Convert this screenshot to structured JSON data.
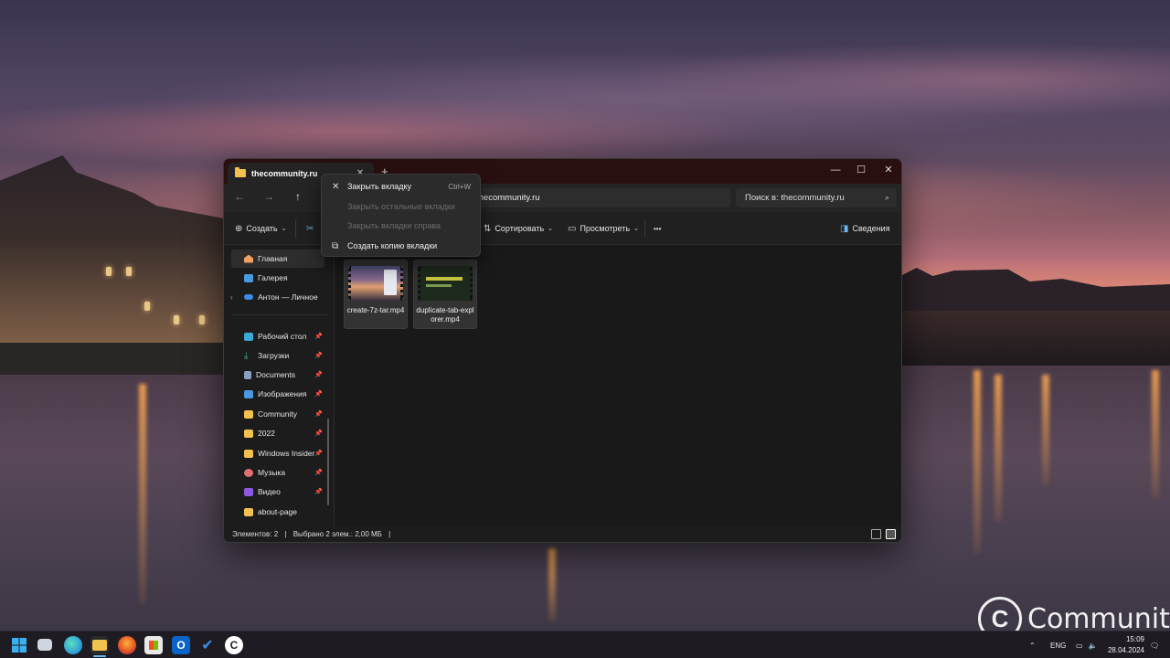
{
  "window": {
    "tab_title": "thecommunity.ru",
    "tab_close": "✕",
    "new_tab": "+",
    "minimize": "—",
    "maximize": "☐",
    "close": "✕"
  },
  "nav": {
    "back": "←",
    "forward": "→",
    "up": "↑",
    "address": "thecommunity.ru",
    "search_placeholder": "Поиск в: thecommunity.ru"
  },
  "toolbar": {
    "create_label": "Создать",
    "sort_label": "Сортировать",
    "view_label": "Просмотреть",
    "more_label": "•••",
    "details_label": "Сведения"
  },
  "context_menu": {
    "items": [
      {
        "label": "Закрыть вкладку",
        "shortcut": "Ctrl+W",
        "icon": "close-icon",
        "enabled": true
      },
      {
        "label": "Закрыть остальные вкладки",
        "shortcut": "",
        "icon": "",
        "enabled": false
      },
      {
        "label": "Закрыть вкладки справа",
        "shortcut": "",
        "icon": "",
        "enabled": false
      },
      {
        "label": "Создать копию вкладки",
        "shortcut": "",
        "icon": "duplicate-icon",
        "enabled": true
      }
    ]
  },
  "sidebar": {
    "items": [
      {
        "label": "Главная",
        "icon": "home-icon",
        "pinned": false
      },
      {
        "label": "Галерея",
        "icon": "gallery-icon",
        "pinned": false
      },
      {
        "label": "Антон — Личное",
        "icon": "onedrive-icon",
        "pinned": false
      },
      {
        "label": "Рабочий стол",
        "icon": "desktop-icon",
        "pinned": true
      },
      {
        "label": "Загрузки",
        "icon": "download-icon",
        "pinned": true
      },
      {
        "label": "Documents",
        "icon": "documents-icon",
        "pinned": true
      },
      {
        "label": "Изображения",
        "icon": "pictures-icon",
        "pinned": true
      },
      {
        "label": "Community",
        "icon": "folder-icon",
        "pinned": true
      },
      {
        "label": "2022",
        "icon": "folder-icon",
        "pinned": true
      },
      {
        "label": "Windows Insider",
        "icon": "folder-icon",
        "pinned": true
      },
      {
        "label": "Музыка",
        "icon": "music-icon",
        "pinned": true
      },
      {
        "label": "Видео",
        "icon": "video-icon",
        "pinned": true
      },
      {
        "label": "about-page",
        "icon": "folder-icon",
        "pinned": false
      }
    ]
  },
  "files": [
    {
      "name": "create-7z-tar.mp4"
    },
    {
      "name": "duplicate-tab-explorer.mp4"
    }
  ],
  "status": {
    "count": "Элементов: 2",
    "selected": "Выбрано 2 элем.: 2,00 МБ"
  },
  "watermark": {
    "text": "Community"
  },
  "taskbar": {
    "lang": "ENG",
    "time": "15:09",
    "date": "28.04.2024"
  },
  "colors": {
    "titlebar": "#2a0f10",
    "folder": "#f2c14e",
    "accent": "#6cb8f0"
  }
}
